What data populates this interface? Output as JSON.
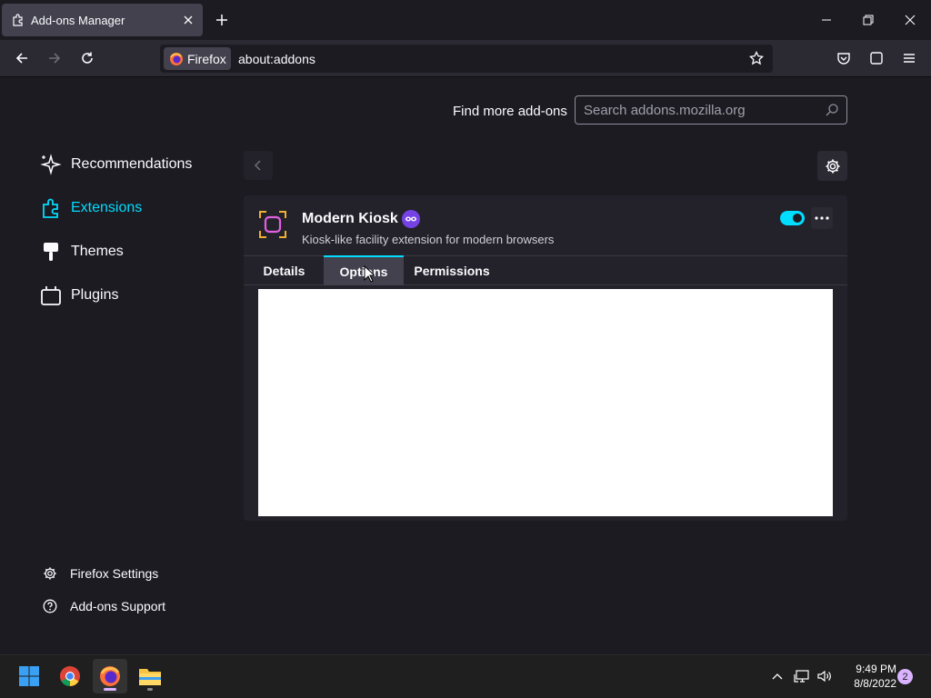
{
  "window": {
    "tab_title": "Add-ons Manager",
    "identity_label": "Firefox",
    "url": "about:addons"
  },
  "header": {
    "find_more_label": "Find more add-ons",
    "search_placeholder": "Search addons.mozilla.org"
  },
  "sidebar": {
    "items": [
      {
        "label": "Recommendations",
        "icon": "sparkle-icon",
        "selected": false
      },
      {
        "label": "Extensions",
        "icon": "puzzle-icon",
        "selected": true
      },
      {
        "label": "Themes",
        "icon": "brush-icon",
        "selected": false
      },
      {
        "label": "Plugins",
        "icon": "plugin-icon",
        "selected": false
      }
    ],
    "footer": [
      {
        "label": "Firefox Settings",
        "icon": "gear-icon"
      },
      {
        "label": "Add-ons Support",
        "icon": "help-icon"
      }
    ]
  },
  "addon": {
    "name": "Modern Kiosk",
    "description": "Kiosk-like facility extension for modern browsers",
    "enabled": true,
    "tabs": [
      "Details",
      "Options",
      "Permissions"
    ],
    "active_tab": "Options"
  },
  "taskbar": {
    "time": "9:49 PM",
    "date": "8/8/2022",
    "notification_count": "2"
  },
  "colors": {
    "accent": "#00ddff",
    "background": "#1c1b22",
    "card": "#23222b",
    "toolbar": "#2b2a33",
    "private_badge": "#7542e5"
  }
}
